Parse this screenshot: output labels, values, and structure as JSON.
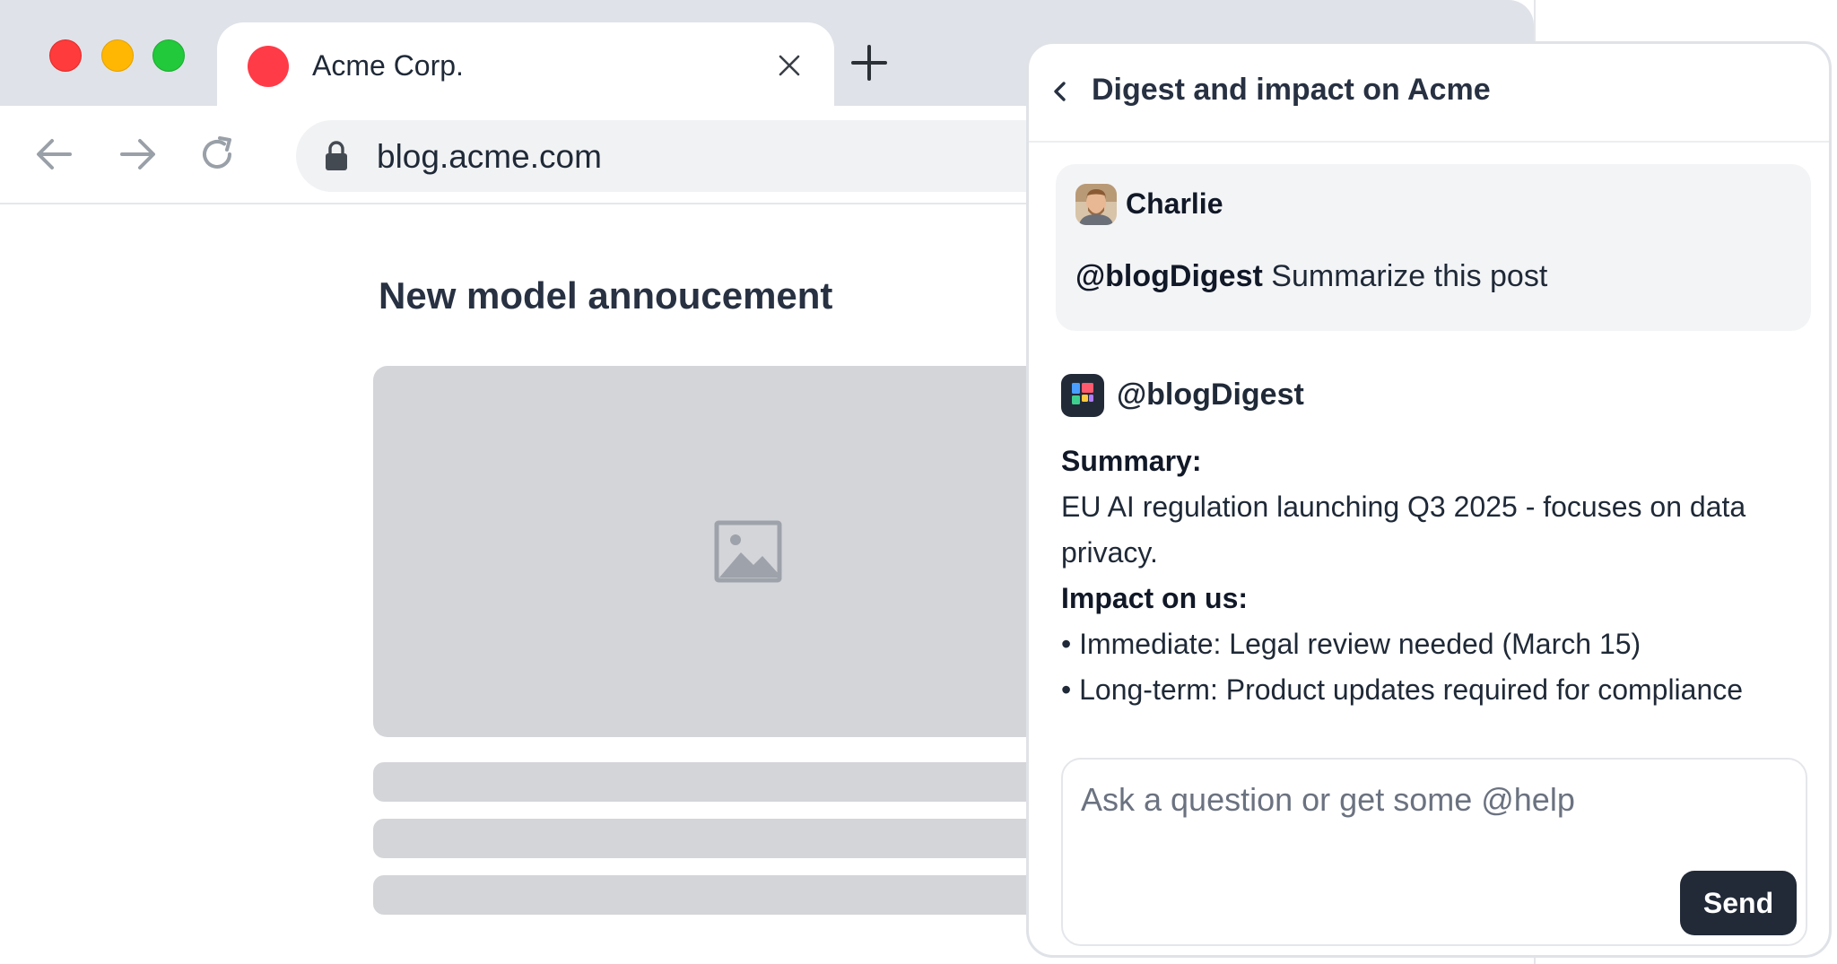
{
  "browser": {
    "tab": {
      "title": "Acme Corp."
    },
    "address_bar": {
      "url": "blog.acme.com"
    }
  },
  "page": {
    "post_title": "New model annoucement"
  },
  "chat": {
    "header_title": "Digest and impact on Acme",
    "user_message": {
      "author": "Charlie",
      "mention": "@blogDigest",
      "text": "Summarize this post"
    },
    "bot_message": {
      "author": "@blogDigest",
      "summary_heading": "Summary:",
      "summary_text": "EU AI regulation launching Q3 2025 - focuses on data privacy.",
      "impact_heading": "Impact on us:",
      "impact_items": [
        "• Immediate: Legal review needed (March 15)",
        "• Long-term: Product updates required for compliance"
      ]
    },
    "composer": {
      "placeholder": "Ask a question or get some @help",
      "send_label": "Send"
    }
  },
  "colors": {
    "tab_favicon": "#ff3b47",
    "traffic_close": "#ff3b3b",
    "traffic_minimize": "#ffb703",
    "traffic_maximize": "#22c93b",
    "send_button": "#222a38"
  },
  "icons": {
    "close_tab": "close-icon",
    "new_tab": "plus-icon",
    "back": "arrow-left-icon",
    "forward": "arrow-right-icon",
    "reload": "reload-icon",
    "lock": "lock-icon",
    "image_placeholder": "image-icon",
    "panel_back": "chevron-left-icon"
  }
}
